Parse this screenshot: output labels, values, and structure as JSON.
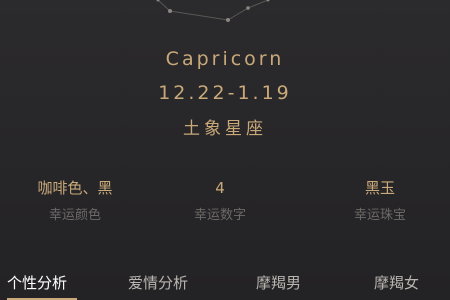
{
  "sign": {
    "name": "Capricorn",
    "dates": "12.22-1.19",
    "element": "土象星座"
  },
  "stats": [
    {
      "value": "咖啡色、黑",
      "label": "幸运颜色"
    },
    {
      "value": "4",
      "label": "幸运数字"
    },
    {
      "value": "黑玉",
      "label": "幸运珠宝"
    }
  ],
  "tabs": [
    {
      "label": "个性分析",
      "active": true
    },
    {
      "label": "爱情分析",
      "active": false
    },
    {
      "label": "摩羯男",
      "active": false
    },
    {
      "label": "摩羯女",
      "active": false
    }
  ],
  "colors": {
    "background": "#262527",
    "accent": "#c9a97a",
    "muted_label": "#6d6a68",
    "tab_text": "#b9b5b1",
    "tab_active": "#ffffff"
  }
}
